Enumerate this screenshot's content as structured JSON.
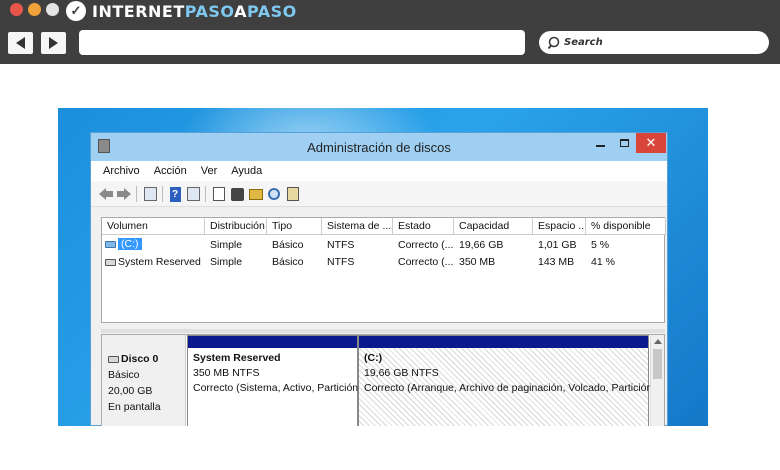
{
  "browser": {
    "brand_part1": "INTERNET",
    "brand_part2": "PASO",
    "brand_part3": "A",
    "brand_part4": "PASO",
    "search_placeholder": "Search"
  },
  "window": {
    "title": "Administración de discos",
    "menu": [
      "Archivo",
      "Acción",
      "Ver",
      "Ayuda"
    ],
    "close_label": "✕"
  },
  "table": {
    "columns": [
      "Volumen",
      "Distribución",
      "Tipo",
      "Sistema de ...",
      "Estado",
      "Capacidad",
      "Espacio ...",
      "% disponible"
    ],
    "rows": [
      {
        "volumen": "(C:)",
        "distribucion": "Simple",
        "tipo": "Básico",
        "sistema": "NTFS",
        "estado": "Correcto (...",
        "capacidad": "19,66 GB",
        "espacio": "1,01 GB",
        "disponible": "5 %"
      },
      {
        "volumen": "System Reserved",
        "distribucion": "Simple",
        "tipo": "Básico",
        "sistema": "NTFS",
        "estado": "Correcto (...",
        "capacidad": "350 MB",
        "espacio": "143 MB",
        "disponible": "41 %"
      }
    ]
  },
  "disk": {
    "name": "Disco 0",
    "type": "Básico",
    "size": "20,00 GB",
    "status": "En pantalla",
    "partitions": [
      {
        "name": "System Reserved",
        "size_fs": "350 MB NTFS",
        "status": "Correcto (Sistema, Activo, Partición p"
      },
      {
        "name": "(C:)",
        "size_fs": "19,66 GB NTFS",
        "status": "Correcto (Arranque, Archivo de paginación, Volcado, Partición pi"
      }
    ]
  },
  "colors": {
    "browser_chrome": "#3f3f3f",
    "desktop": "#1c8fdc",
    "titlebar": "#9fd0f4",
    "close_button": "#d9453a",
    "partition_bar": "#0a1a8e",
    "selection": "#3399ff"
  }
}
